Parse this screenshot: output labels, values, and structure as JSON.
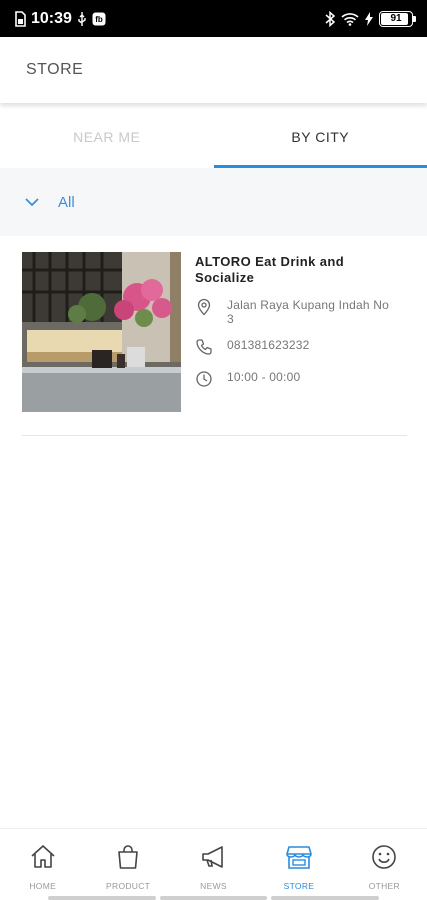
{
  "status_bar": {
    "time": "10:39",
    "battery": "91",
    "battery_level": 0.91
  },
  "header": {
    "title": "STORE"
  },
  "tabs": [
    {
      "label": "NEAR ME",
      "active": false
    },
    {
      "label": "BY CITY",
      "active": true
    }
  ],
  "filter": {
    "selected": "All",
    "icon": "chevron-down-icon"
  },
  "store": {
    "name": "ALTORO Eat Drink and Socialize",
    "address": "Jalan Raya Kupang Indah No 3",
    "phone": "081381623232",
    "hours": "10:00 - 00:00"
  },
  "nav": [
    {
      "label": "HOME",
      "icon": "home-icon",
      "active": false
    },
    {
      "label": "PRODUCT",
      "icon": "shopping-bag-icon",
      "active": false
    },
    {
      "label": "NEWS",
      "icon": "megaphone-icon",
      "active": false
    },
    {
      "label": "STORE",
      "icon": "store-icon",
      "active": true
    },
    {
      "label": "OTHER",
      "icon": "smiley-icon",
      "active": false
    }
  ],
  "colors": {
    "accent": "#2a8ce0",
    "filter_text": "#3d8fd6",
    "inactive_tab": "#c9c9c9",
    "filter_bg": "#f6f7f8"
  }
}
